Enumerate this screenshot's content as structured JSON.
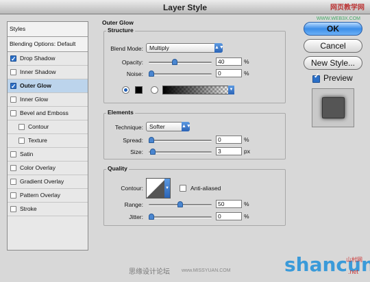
{
  "window": {
    "title": "Layer Style"
  },
  "watermarks": {
    "top_right": "网页教学网",
    "top_url": "WWW.WEB3X.COM",
    "bottom_cn": "思缘设计论坛",
    "bottom_url": "www.MISSYUAN.COM",
    "logo": "shancun",
    "logo_cn": "山村网",
    "logo_net": ".net"
  },
  "styles_list": {
    "header": "Styles",
    "blending": "Blending Options: Default",
    "items": [
      {
        "label": "Drop Shadow",
        "checked": true,
        "indent": false,
        "selected": false
      },
      {
        "label": "Inner Shadow",
        "checked": false,
        "indent": false,
        "selected": false
      },
      {
        "label": "Outer Glow",
        "checked": true,
        "indent": false,
        "selected": true
      },
      {
        "label": "Inner Glow",
        "checked": false,
        "indent": false,
        "selected": false
      },
      {
        "label": "Bevel and Emboss",
        "checked": false,
        "indent": false,
        "selected": false
      },
      {
        "label": "Contour",
        "checked": false,
        "indent": true,
        "selected": false
      },
      {
        "label": "Texture",
        "checked": false,
        "indent": true,
        "selected": false
      },
      {
        "label": "Satin",
        "checked": false,
        "indent": false,
        "selected": false
      },
      {
        "label": "Color Overlay",
        "checked": false,
        "indent": false,
        "selected": false
      },
      {
        "label": "Gradient Overlay",
        "checked": false,
        "indent": false,
        "selected": false
      },
      {
        "label": "Pattern Overlay",
        "checked": false,
        "indent": false,
        "selected": false
      },
      {
        "label": "Stroke",
        "checked": false,
        "indent": false,
        "selected": false
      }
    ]
  },
  "outer_glow": {
    "title": "Outer Glow",
    "structure": {
      "title": "Structure",
      "blend_mode_label": "Blend Mode:",
      "blend_mode": "Multiply",
      "opacity_label": "Opacity:",
      "opacity": "40",
      "opacity_fraction": 0.4,
      "noise_label": "Noise:",
      "noise": "0",
      "noise_fraction": 0.0,
      "unit": "%",
      "glow_color": "#000000"
    },
    "elements": {
      "title": "Elements",
      "technique_label": "Technique:",
      "technique": "Softer",
      "spread_label": "Spread:",
      "spread": "0",
      "spread_fraction": 0.0,
      "spread_unit": "%",
      "size_label": "Size:",
      "size": "3",
      "size_fraction": 0.02,
      "size_unit": "px"
    },
    "quality": {
      "title": "Quality",
      "contour_label": "Contour:",
      "anti_aliased_label": "Anti-aliased",
      "anti_aliased": false,
      "range_label": "Range:",
      "range": "50",
      "range_fraction": 0.5,
      "jitter_label": "Jitter:",
      "jitter": "0",
      "jitter_fraction": 0.0,
      "unit": "%"
    }
  },
  "buttons": {
    "ok": "OK",
    "cancel": "Cancel",
    "new_style": "New Style..."
  },
  "preview": {
    "label": "Preview",
    "checked": true
  }
}
